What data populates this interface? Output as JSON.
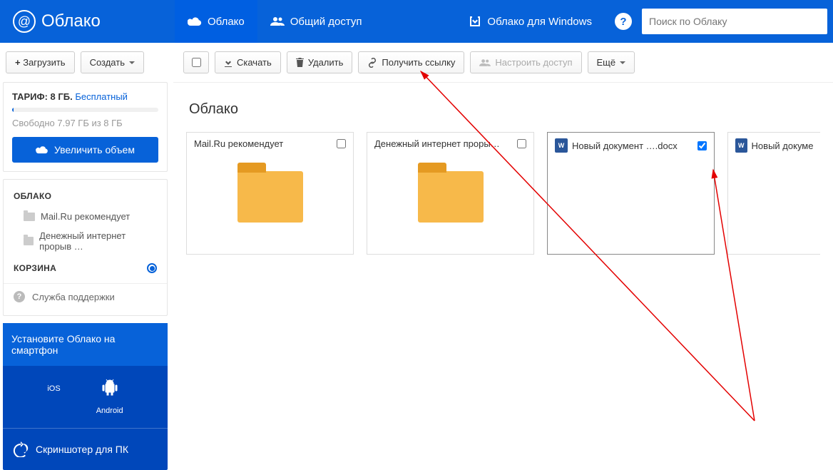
{
  "header": {
    "logo_text": "Облако",
    "nav_cloud": "Облако",
    "nav_shared": "Общий доступ",
    "nav_windows": "Облако для Windows",
    "search_placeholder": "Поиск по Облаку"
  },
  "sidebar": {
    "btn_upload": "Загрузить",
    "btn_create": "Создать",
    "tariff_label": "ТАРИФ: 8 ГБ.",
    "tariff_plan": "Бесплатный",
    "free_text": "Свободно 7.97 ГБ из 8 ГБ",
    "btn_upgrade": "Увеличить объем",
    "section_cloud": "ОБЛАКО",
    "tree": [
      "Mail.Ru рекомендует",
      "Денежный интернет прорыв …"
    ],
    "section_trash": "КОРЗИНА",
    "support": "Служба поддержки",
    "promo_title": "Установите Облако на смартфон",
    "platform_ios": "iOS",
    "platform_android": "Android",
    "screenshoter": "Скриншотер для ПК"
  },
  "toolbar": {
    "download": "Скачать",
    "delete": "Удалить",
    "get_link": "Получить ссылку",
    "configure_access": "Настроить доступ",
    "more": "Ещё"
  },
  "breadcrumb": "Облако",
  "files": [
    {
      "name": "Mail.Ru рекомендует",
      "type": "folder",
      "checked": false
    },
    {
      "name": "Денежный интернет проры…",
      "type": "folder",
      "checked": false
    },
    {
      "name": "Новый документ ….docx",
      "type": "docx",
      "checked": true
    },
    {
      "name": "Новый докумен",
      "type": "docx",
      "checked": false
    }
  ]
}
